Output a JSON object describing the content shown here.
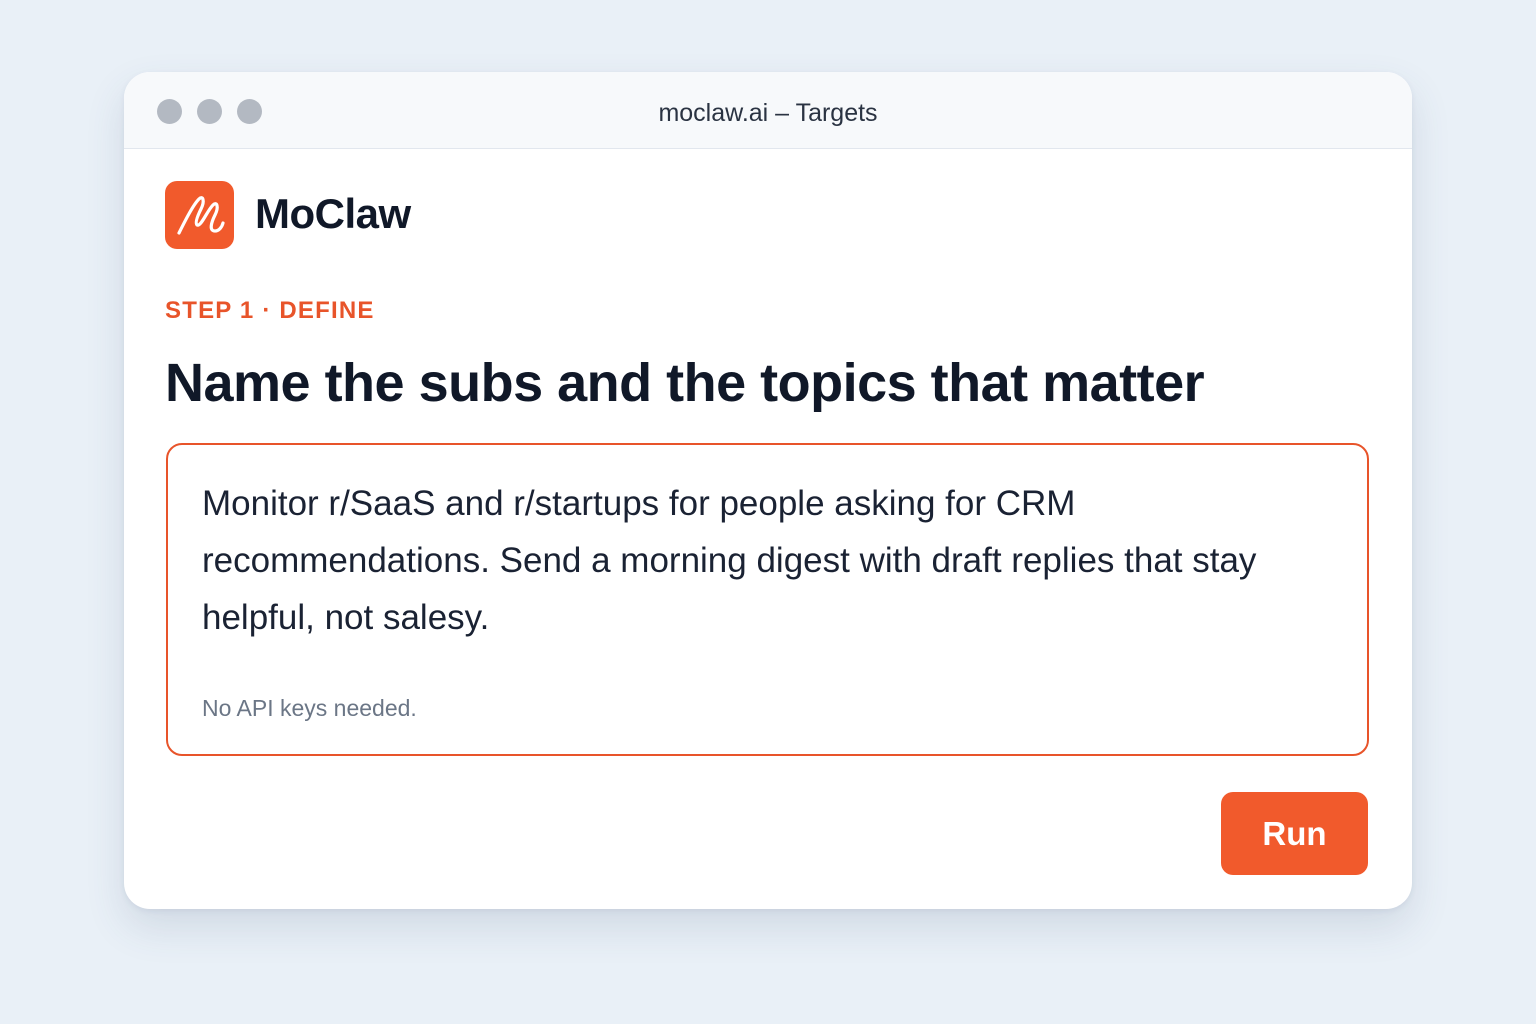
{
  "window": {
    "title": "moclaw.ai – Targets"
  },
  "brand": {
    "name": "MoClaw",
    "logo_icon": "moclaw-logo-icon",
    "accent_color": "#f15a2c"
  },
  "step": {
    "label": "STEP 1 · DEFINE"
  },
  "heading": "Name the subs and the topics that matter",
  "prompt": {
    "value": "Monitor r/SaaS and r/startups for people asking for CRM recommendations. Send a morning digest with draft replies that stay helpful, not salesy.",
    "note": "No API keys needed."
  },
  "actions": {
    "run_label": "Run"
  }
}
